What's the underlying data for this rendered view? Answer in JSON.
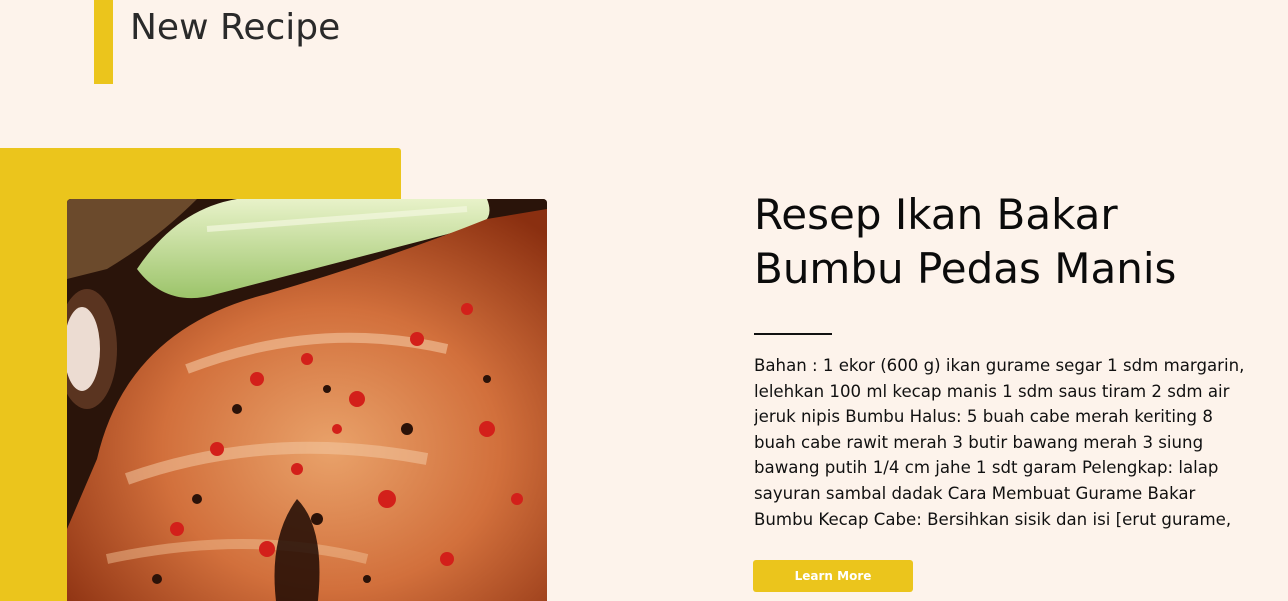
{
  "section": {
    "title": "New Recipe"
  },
  "recipe": {
    "title": "Resep Ikan Bakar Bumbu Pedas Manis",
    "description": "Bahan : 1 ekor (600 g) ikan gurame segar 1 sdm margarin, lelehkan 100 ml kecap manis 1 sdm saus tiram 2 sdm air jeruk nipis Bumbu Halus: 5 buah cabe merah keriting 8 buah cabe rawit merah 3 butir bawang merah 3 siung bawang putih 1/4 cm jahe 1 sdt garam Pelengkap: lalap sayuran sambal dadak Cara Membuat Gurame Bakar Bumbu Kecap Cabe: Bersihkan sisik dan isi [erut gurame,",
    "button_label": "Learn More"
  },
  "colors": {
    "accent": "#ebc51c",
    "background": "#fdf3eb"
  }
}
